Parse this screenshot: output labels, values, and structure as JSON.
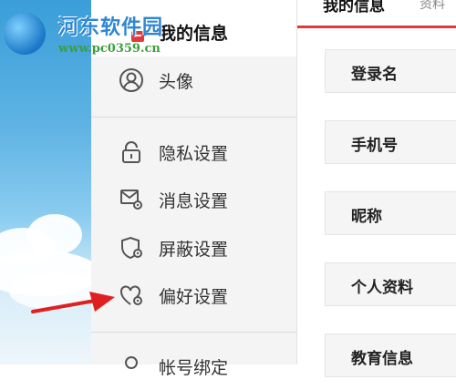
{
  "watermark": {
    "title": "河东软件园",
    "url": "www.pc0359.cn"
  },
  "sidebar": {
    "header_title": "我的信息",
    "items": [
      {
        "label": "头像",
        "icon": "avatar-icon"
      },
      {
        "label": "隐私设置",
        "icon": "lock-icon"
      },
      {
        "label": "消息设置",
        "icon": "message-settings-icon"
      },
      {
        "label": "屏蔽设置",
        "icon": "shield-settings-icon"
      },
      {
        "label": "偏好设置",
        "icon": "heart-settings-icon"
      },
      {
        "label": "帐号绑定",
        "icon": "account-bind-icon"
      }
    ]
  },
  "main": {
    "tab_active": "我的信息",
    "tab_other": "资料",
    "rows": [
      {
        "label": "登录名"
      },
      {
        "label": "手机号"
      },
      {
        "label": "昵称"
      },
      {
        "label": "个人资料"
      },
      {
        "label": "教育信息"
      }
    ]
  },
  "colors": {
    "accent_red": "#e23a3a",
    "arrow_red": "#e02020",
    "sidebar_bg": "#f4f4f4"
  }
}
